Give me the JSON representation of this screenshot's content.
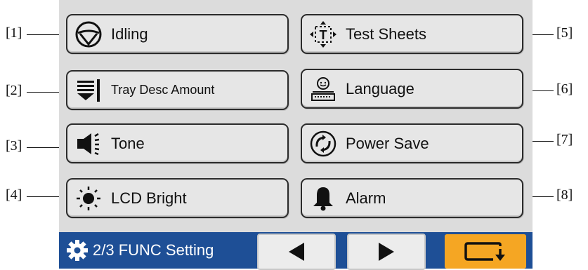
{
  "buttons": {
    "idling": "Idling",
    "tray_desc": "Tray Desc Amount",
    "tone": "Tone",
    "lcd_bright": "LCD Bright",
    "test_sheets": "Test Sheets",
    "language": "Language",
    "power_save": "Power Save",
    "alarm": "Alarm"
  },
  "callouts": {
    "c1": "[1]",
    "c2": "[2]",
    "c3": "[3]",
    "c4": "[4]",
    "c5": "[5]",
    "c6": "[6]",
    "c7": "[7]",
    "c8": "[8]"
  },
  "footer": {
    "page_title": "2/3 FUNC Setting"
  },
  "icons": {
    "idling": "steering-wheel-icon",
    "tray_desc": "tray-descend-icon",
    "tone": "speaker-icon",
    "lcd_bright": "sun-icon",
    "test_sheets": "test-sheet-icon",
    "language": "language-keyboard-icon",
    "power_save": "power-save-icon",
    "alarm": "bell-icon",
    "settings": "gear-icon",
    "prev": "left-arrow-icon",
    "next": "right-arrow-icon",
    "return": "return-icon"
  },
  "colors": {
    "bar": "#1e4f96",
    "return": "#f5a623"
  }
}
